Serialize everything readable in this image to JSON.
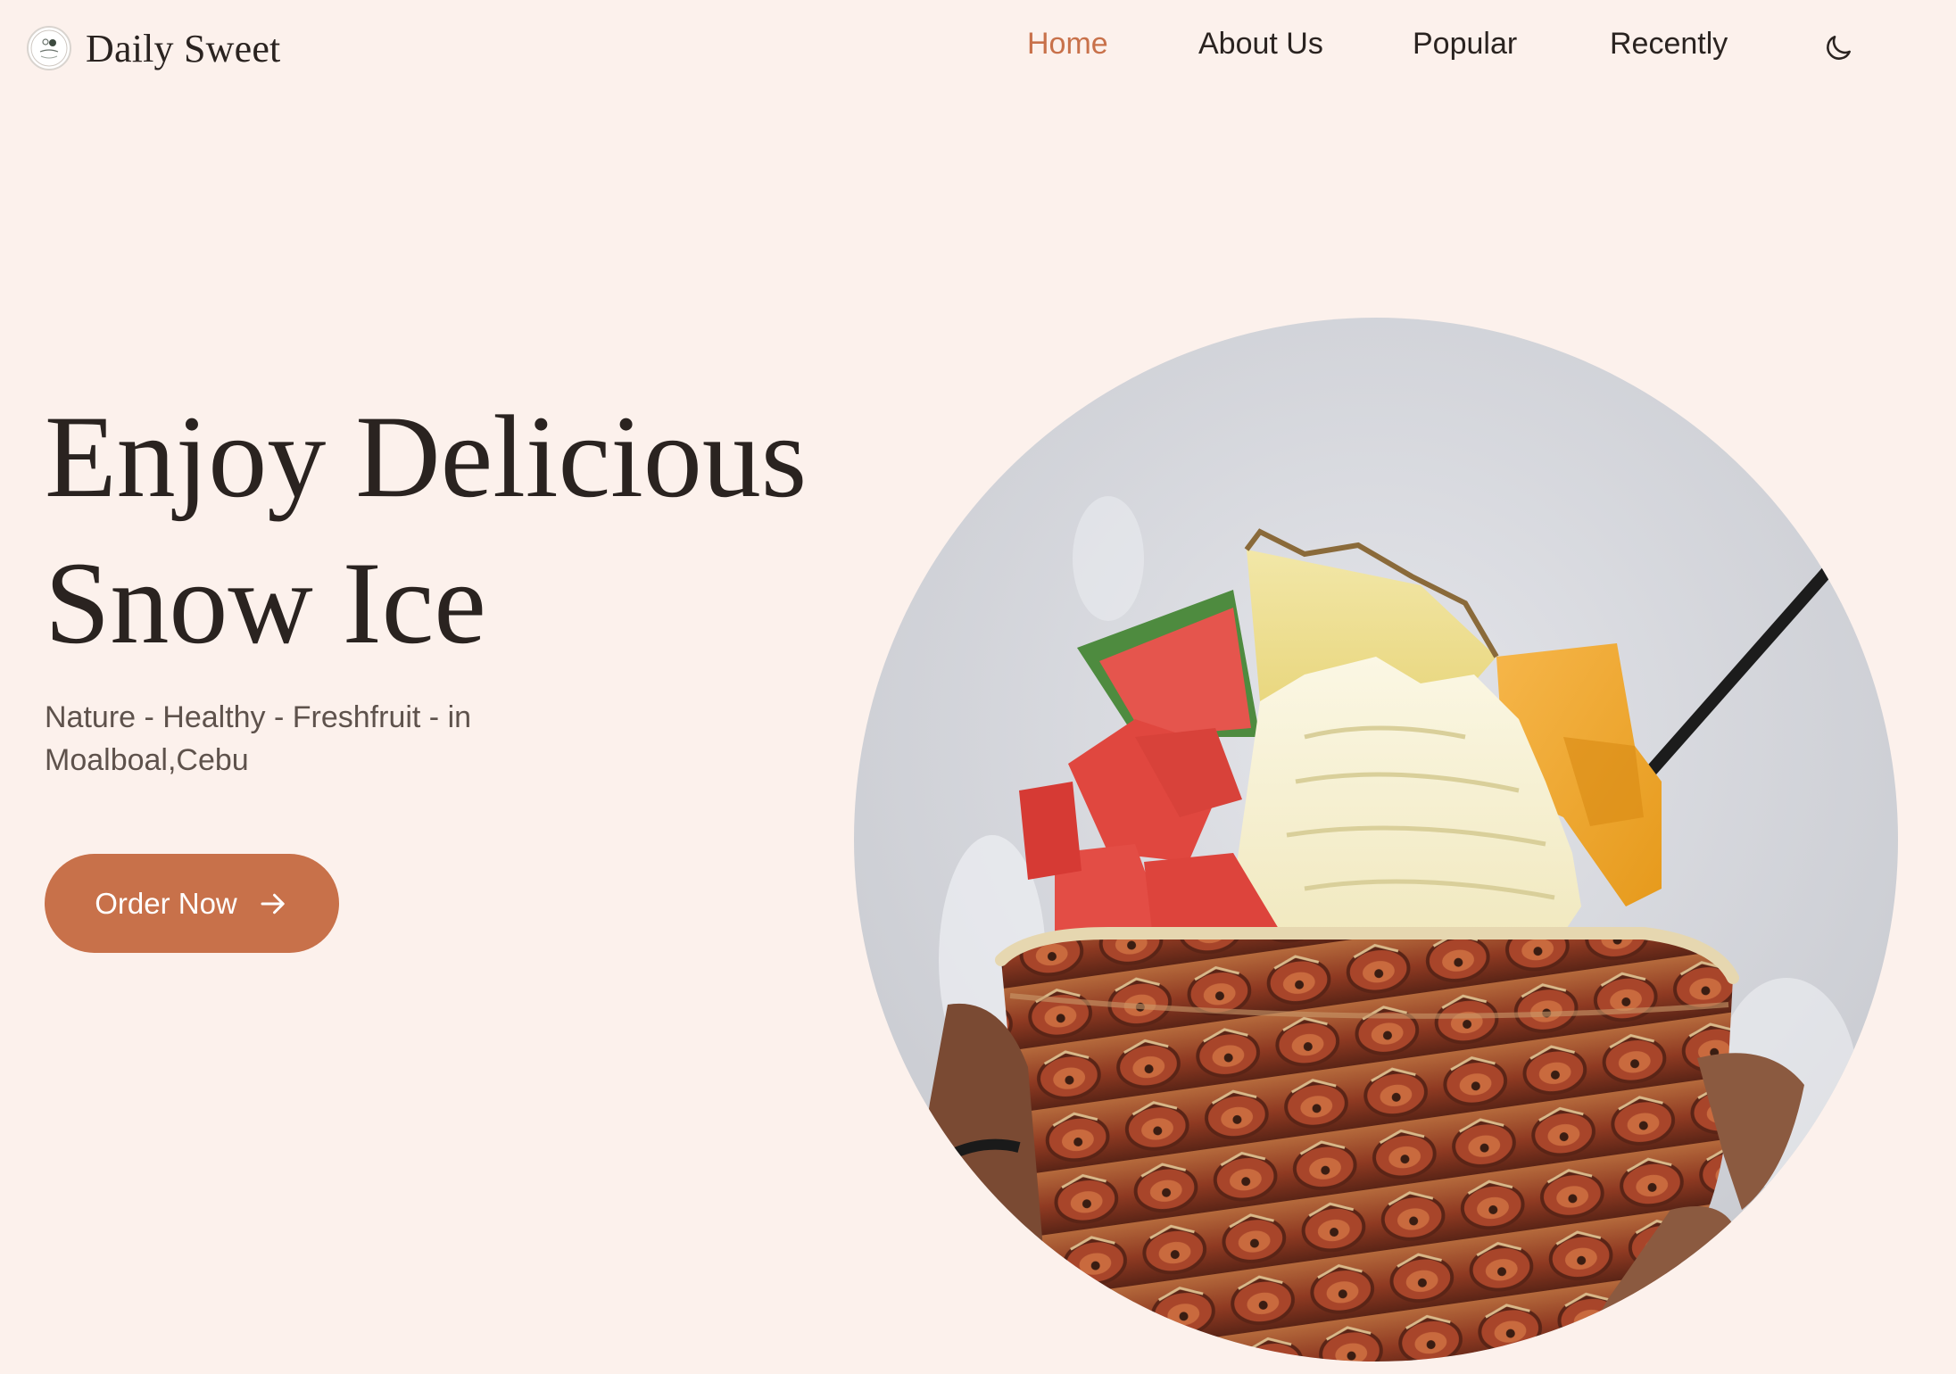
{
  "brand": {
    "name": "Daily Sweet",
    "logo_text": "Daily Sweet"
  },
  "nav": {
    "items": [
      {
        "label": "Home",
        "active": true
      },
      {
        "label": "About Us",
        "active": false
      },
      {
        "label": "Popular",
        "active": false
      },
      {
        "label": "Recently",
        "active": false
      }
    ],
    "theme_toggle_icon": "moon-icon"
  },
  "hero": {
    "title_line1": "Enjoy Delicious",
    "title_line2": "Snow Ice",
    "subtitle_line1": "Nature - Healthy - Freshfruit - in",
    "subtitle_line2": "Moalboal,Cebu",
    "cta_label": "Order Now",
    "cta_icon": "arrow-right-icon",
    "image_subject": "snow ice with fresh fruit in a pineapple bowl"
  },
  "colors": {
    "background": "#fcf1ec",
    "accent": "#c8714a",
    "text": "#2a2320",
    "muted_text": "#5e524c"
  }
}
